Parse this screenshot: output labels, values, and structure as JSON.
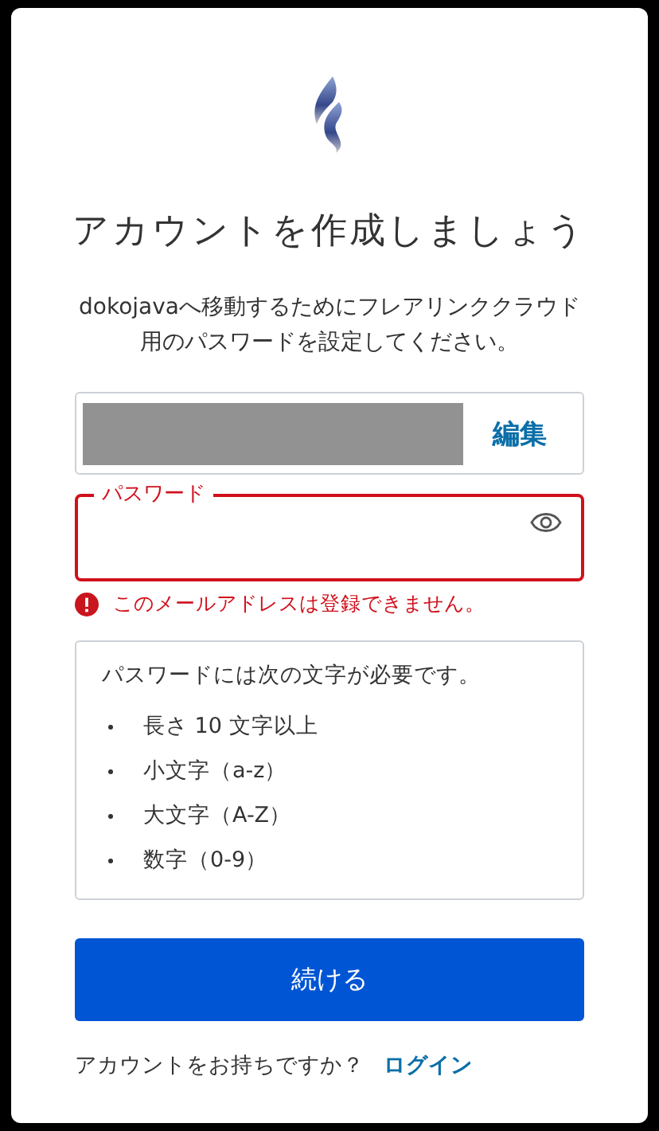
{
  "title": "アカウントを作成しましょう",
  "subtitle": "dokojavaへ移動するためにフレアリンククラウド用のパスワードを設定してください。",
  "email": {
    "edit_label": "編集"
  },
  "password": {
    "label": "パスワード",
    "error": true,
    "error_message": "このメールアドレスは登録できません。"
  },
  "requirements": {
    "heading": "パスワードには次の文字が必要です。",
    "items": [
      "長さ 10 文字以上",
      "小文字（a-z）",
      "大文字（A-Z）",
      "数字（0-9）"
    ]
  },
  "continue_button": "続ける",
  "login_prompt": {
    "text": "アカウントをお持ちですか？",
    "link": "ログイン"
  }
}
